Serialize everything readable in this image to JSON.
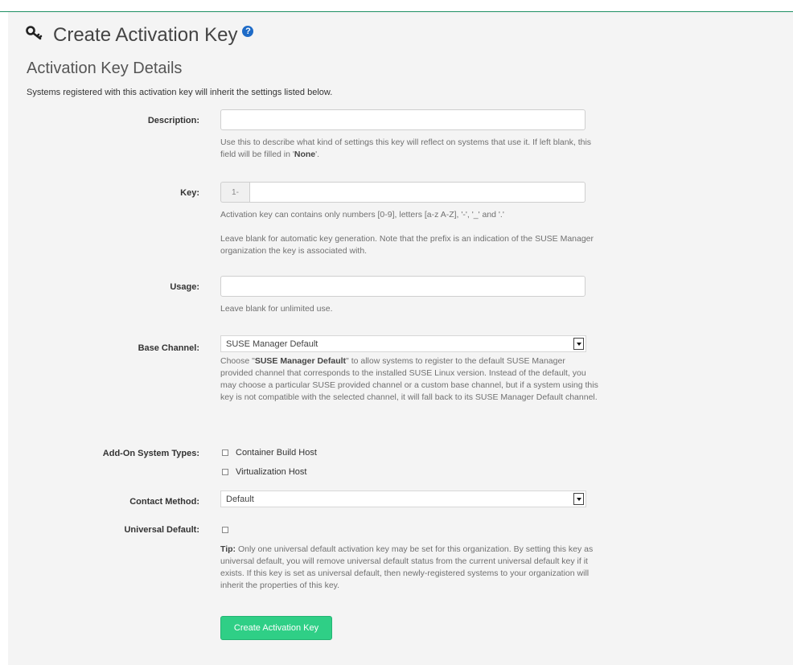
{
  "page": {
    "title": "Create Activation Key",
    "help_icon": "question-circle-icon",
    "title_icon": "key-icon"
  },
  "section": {
    "title": "Activation Key Details",
    "intro": "Systems registered with this activation key will inherit the settings listed below."
  },
  "form": {
    "description": {
      "label": "Description:",
      "value": "",
      "help_prefix": "Use this to describe what kind of settings this key will reflect on systems that use it. If left blank, this field will be filled in '",
      "help_bold": "None",
      "help_suffix": "'."
    },
    "key": {
      "label": "Key:",
      "prefix": "1-",
      "value": "",
      "help1": "Activation key can contains only numbers [0-9], letters [a-z A-Z], '-', '_' and '.'",
      "help2": "Leave blank for automatic key generation. Note that the prefix is an indication of the SUSE Manager organization the key is associated with."
    },
    "usage": {
      "label": "Usage:",
      "value": "",
      "help": "Leave blank for unlimited use."
    },
    "base_channel": {
      "label": "Base Channel:",
      "selected": "SUSE Manager Default",
      "help_prefix": "Choose \"",
      "help_bold": "SUSE Manager Default",
      "help_suffix": "\" to allow systems to register to the default SUSE Manager provided channel that corresponds to the installed SUSE Linux version. Instead of the default, you may choose a particular SUSE provided channel or a custom base channel, but if a system using this key is not compatible with the selected channel, it will fall back to its SUSE Manager Default channel."
    },
    "addon": {
      "label": "Add-On System Types:",
      "options": [
        "Container Build Host",
        "Virtualization Host"
      ]
    },
    "contact_method": {
      "label": "Contact Method:",
      "selected": "Default"
    },
    "universal_default": {
      "label": "Universal Default:",
      "tip_bold": "Tip:",
      "tip": " Only one universal default activation key may be set for this organization. By setting this key as universal default, you will remove universal default status from the current universal default key if it exists. If this key is set as universal default, then newly-registered systems to your organization will inherit the properties of this key."
    },
    "submit_label": "Create Activation Key"
  },
  "colors": {
    "accent": "#2fcf86",
    "help_icon": "#1e6bc7",
    "top_line": "#1f8f63"
  }
}
